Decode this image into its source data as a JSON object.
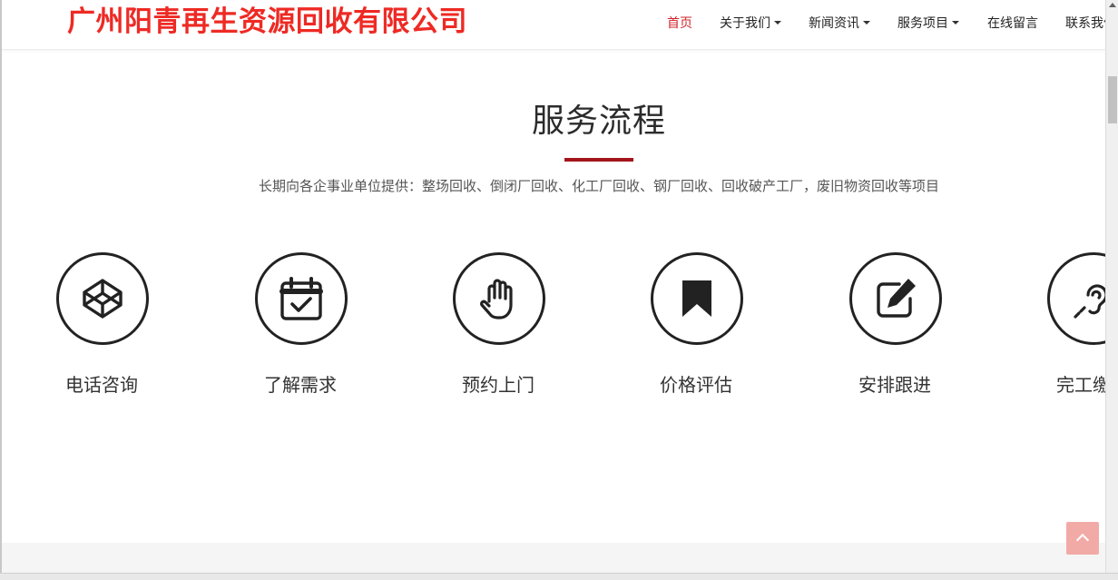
{
  "header": {
    "logo_text": "广州阳青再生资源回收有限公司",
    "nav": [
      {
        "label": "首页",
        "active": true,
        "dropdown": false
      },
      {
        "label": "关于我们",
        "active": false,
        "dropdown": true
      },
      {
        "label": "新闻资讯",
        "active": false,
        "dropdown": true
      },
      {
        "label": "服务项目",
        "active": false,
        "dropdown": true
      },
      {
        "label": "在线留言",
        "active": false,
        "dropdown": false
      },
      {
        "label": "联系我们",
        "active": false,
        "dropdown": false
      }
    ]
  },
  "main": {
    "title": "服务流程",
    "subtitle": "长期向各企事业单位提供：整场回收、倒闭厂回收、化工厂回收、钢厂回收、回收破产工厂，废旧物资回收等项目",
    "steps": [
      {
        "label": "电话咨询",
        "icon": "codepen-icon"
      },
      {
        "label": "了解需求",
        "icon": "calendar-check-icon"
      },
      {
        "label": "预约上门",
        "icon": "hand-icon"
      },
      {
        "label": "价格评估",
        "icon": "bookmark-icon"
      },
      {
        "label": "安排跟进",
        "icon": "edit-icon"
      },
      {
        "label": "完工缴纳",
        "icon": "hearing-icon"
      }
    ]
  },
  "colors": {
    "logo": "#ee2a24",
    "nav_active": "#d2242a",
    "title_underline": "#a4151b",
    "back_to_top": "#f2aaa6"
  }
}
